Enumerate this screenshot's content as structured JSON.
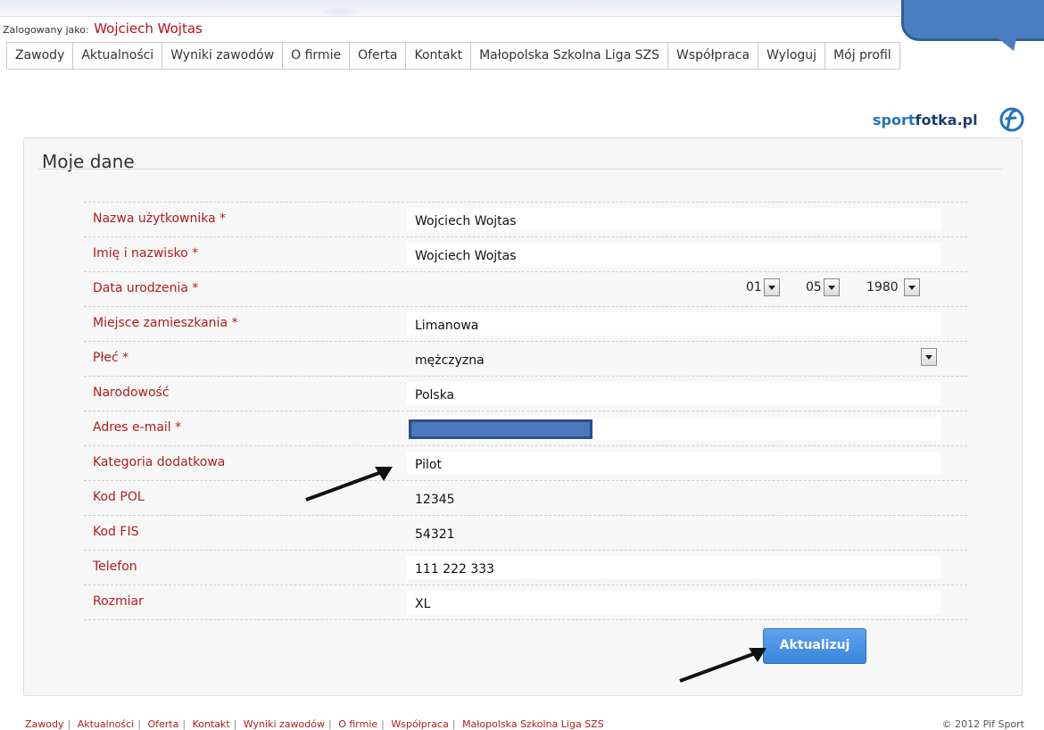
{
  "header": {
    "logged_as_label": "Zalogowany jako:",
    "username": "Wojciech Wojtas"
  },
  "nav": {
    "items": [
      "Zawody",
      "Aktualności",
      "Wyniki zawodów",
      "O firmie",
      "Oferta",
      "Kontakt",
      "Małopolska Szkolna Liga SZS",
      "Współpraca",
      "Wyloguj",
      "Mój profil"
    ]
  },
  "brand": {
    "prefix": "sport",
    "mid": "fotka",
    "suffix": ".pl",
    "color": "#2173bc"
  },
  "panel": {
    "title": "Moje dane"
  },
  "form": {
    "username": {
      "label": "Nazwa użytkownika *",
      "value": "Wojciech Wojtas"
    },
    "fullname": {
      "label": "Imię i nazwisko *",
      "value": "Wojciech Wojtas"
    },
    "birthdate": {
      "label": "Data urodzenia *",
      "day": "01",
      "month": "05",
      "year": "1980"
    },
    "residence": {
      "label": "Miejsce zamieszkania *",
      "value": "Limanowa"
    },
    "gender": {
      "label": "Płeć *",
      "value": "mężczyzna"
    },
    "nationality": {
      "label": "Narodowość",
      "value": "Polska"
    },
    "email": {
      "label": "Adres e-mail *",
      "value": ""
    },
    "category": {
      "label": "Kategoria dodatkowa",
      "value": "Pilot"
    },
    "kod_pol": {
      "label": "Kod POL",
      "value": "12345"
    },
    "kod_fis": {
      "label": "Kod FIS",
      "value": "54321"
    },
    "phone": {
      "label": "Telefon",
      "value": "111 222 333"
    },
    "size": {
      "label": "Rozmiar",
      "value": "XL"
    },
    "submit_label": "Aktualizuj"
  },
  "footer": {
    "links": [
      "Zawody",
      "Aktualności",
      "Oferta",
      "Kontakt",
      "Wyniki zawodów",
      "O firmie",
      "Współpraca",
      "Małopolska Szkolna Liga SZS"
    ],
    "copyright": "© 2012 Pif Sport"
  },
  "colors": {
    "label_red": "#b01c1c",
    "button_blue": "#3a85d9",
    "mask_blue": "#4a79bd"
  }
}
